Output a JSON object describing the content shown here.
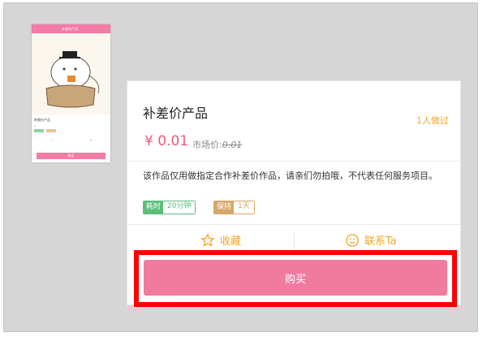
{
  "thumbnail": {
    "header_title": "补差价产品",
    "title": "补差价产品",
    "buy_label": "购买"
  },
  "product": {
    "title": "补差价产品",
    "buyers": "1人做过",
    "price": "¥ 0.01",
    "market_label": "市场价:",
    "market_price": "0.01",
    "description": "该作品仅用做指定合作补差价作品，请亲们勿拍哦，不代表任何服务项目。"
  },
  "tags": {
    "time_key": "耗时",
    "time_value": "20分钟",
    "keep_key": "保持",
    "keep_value": "1天"
  },
  "actions": {
    "favorite_label": "收藏",
    "contact_label": "联系Ta"
  },
  "buy_button": {
    "label": "购买"
  },
  "colors": {
    "accent_pink": "#f07aa0",
    "price_pink": "#f05a78",
    "orange": "#f5a623",
    "highlight_red": "#ff0000"
  }
}
